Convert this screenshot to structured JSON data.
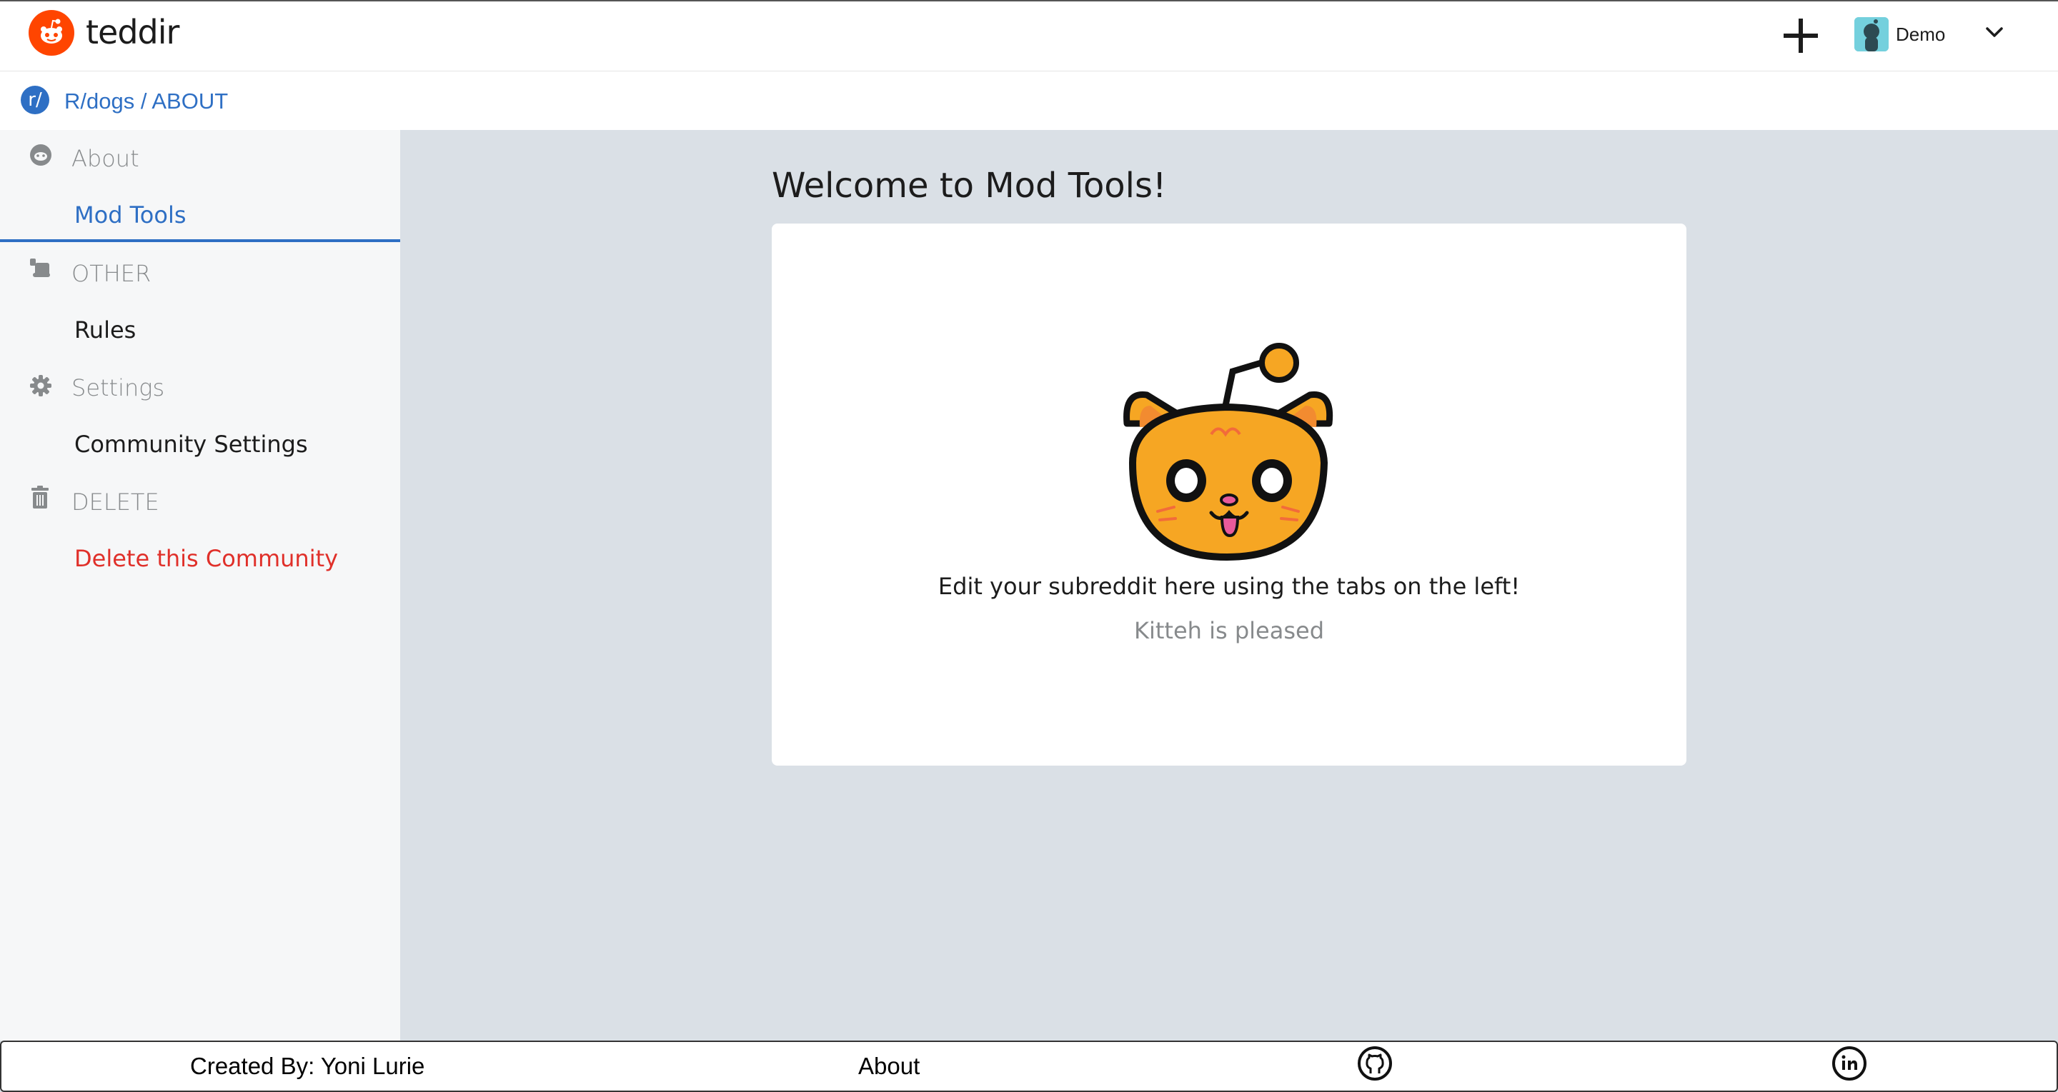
{
  "app": {
    "brand": "teddir"
  },
  "header": {
    "user_name": "Demo"
  },
  "breadcrumb": {
    "icon": "r/",
    "text": "R/dogs / ABOUT"
  },
  "sidebar": {
    "sections": [
      {
        "icon": "reddit-face-icon",
        "label": "About",
        "items": [
          {
            "label": "Mod Tools",
            "active": true
          }
        ]
      },
      {
        "icon": "scroll-icon",
        "label": "OTHER",
        "items": [
          {
            "label": "Rules"
          }
        ]
      },
      {
        "icon": "gear-icon",
        "label": "Settings",
        "items": [
          {
            "label": "Community Settings"
          }
        ]
      },
      {
        "icon": "trash-icon",
        "label": "DELETE",
        "items": [
          {
            "label": "Delete this Community",
            "danger": true
          }
        ]
      }
    ]
  },
  "main": {
    "title": "Welcome to Mod Tools!",
    "message": "Edit your subreddit here using the tabs on the left!",
    "caption": "Kitteh is pleased"
  },
  "footer": {
    "credit": "Created By: Yoni Lurie",
    "about": "About",
    "icons": [
      "github-icon",
      "linkedin-icon"
    ]
  },
  "colors": {
    "accent": "#2e6fc4",
    "brand": "#ff4500",
    "danger": "#e0302a",
    "background": "#dae0e6"
  }
}
